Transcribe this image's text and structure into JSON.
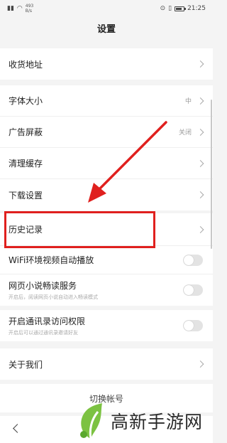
{
  "status_bar": {
    "net_speed": "493",
    "net_unit": "B/s",
    "time": "21:25"
  },
  "header": {
    "title": "设置"
  },
  "settings": {
    "address": {
      "label": "收货地址"
    },
    "font_size": {
      "label": "字体大小",
      "value": "中"
    },
    "ad_block": {
      "label": "广告屏蔽",
      "value": "关闭"
    },
    "clear_cache": {
      "label": "清理缓存"
    },
    "download": {
      "label": "下载设置"
    },
    "history": {
      "label": "历史记录"
    },
    "wifi_autoplay": {
      "label": "WiFi环境视频自动播放",
      "enabled": false
    },
    "novel_service": {
      "label": "网页小说畅读服务",
      "desc": "开启后，阅读网页小说自动进入畅读模式",
      "enabled": false
    },
    "contacts_permission": {
      "label": "开启通讯录访问权限",
      "desc": "开启后可以通过通讯录邀请好友",
      "enabled": false
    },
    "about": {
      "label": "关于我们"
    }
  },
  "switch_account": {
    "label": "切换帐号"
  },
  "annotation": {
    "color": "#e0201e"
  },
  "watermark": {
    "text": "高新手游网"
  }
}
